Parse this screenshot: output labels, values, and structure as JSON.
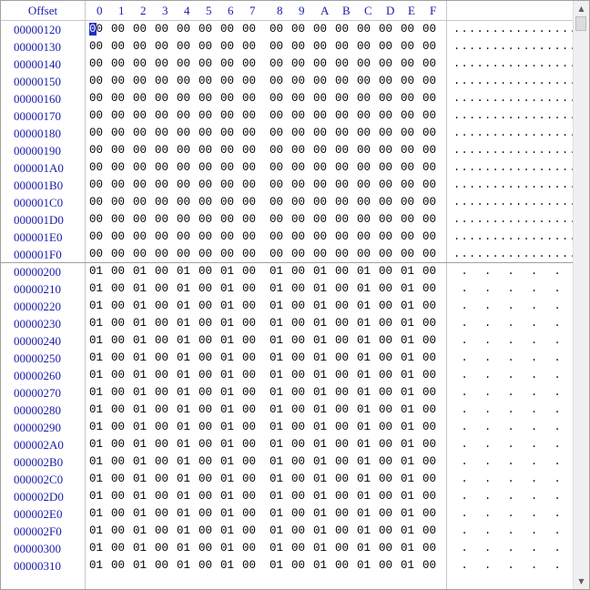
{
  "header": {
    "offset_label": "Offset",
    "columns": [
      "0",
      "1",
      "2",
      "3",
      "4",
      "5",
      "6",
      "7",
      "8",
      "9",
      "A",
      "B",
      "C",
      "D",
      "E",
      "F"
    ]
  },
  "rows": [
    {
      "offset": "00000120",
      "bytes": [
        "00",
        "00",
        "00",
        "00",
        "00",
        "00",
        "00",
        "00",
        "00",
        "00",
        "00",
        "00",
        "00",
        "00",
        "00",
        "00"
      ],
      "ascii": "................"
    },
    {
      "offset": "00000130",
      "bytes": [
        "00",
        "00",
        "00",
        "00",
        "00",
        "00",
        "00",
        "00",
        "00",
        "00",
        "00",
        "00",
        "00",
        "00",
        "00",
        "00"
      ],
      "ascii": "................"
    },
    {
      "offset": "00000140",
      "bytes": [
        "00",
        "00",
        "00",
        "00",
        "00",
        "00",
        "00",
        "00",
        "00",
        "00",
        "00",
        "00",
        "00",
        "00",
        "00",
        "00"
      ],
      "ascii": "................"
    },
    {
      "offset": "00000150",
      "bytes": [
        "00",
        "00",
        "00",
        "00",
        "00",
        "00",
        "00",
        "00",
        "00",
        "00",
        "00",
        "00",
        "00",
        "00",
        "00",
        "00"
      ],
      "ascii": "................"
    },
    {
      "offset": "00000160",
      "bytes": [
        "00",
        "00",
        "00",
        "00",
        "00",
        "00",
        "00",
        "00",
        "00",
        "00",
        "00",
        "00",
        "00",
        "00",
        "00",
        "00"
      ],
      "ascii": "................"
    },
    {
      "offset": "00000170",
      "bytes": [
        "00",
        "00",
        "00",
        "00",
        "00",
        "00",
        "00",
        "00",
        "00",
        "00",
        "00",
        "00",
        "00",
        "00",
        "00",
        "00"
      ],
      "ascii": "................"
    },
    {
      "offset": "00000180",
      "bytes": [
        "00",
        "00",
        "00",
        "00",
        "00",
        "00",
        "00",
        "00",
        "00",
        "00",
        "00",
        "00",
        "00",
        "00",
        "00",
        "00"
      ],
      "ascii": "................"
    },
    {
      "offset": "00000190",
      "bytes": [
        "00",
        "00",
        "00",
        "00",
        "00",
        "00",
        "00",
        "00",
        "00",
        "00",
        "00",
        "00",
        "00",
        "00",
        "00",
        "00"
      ],
      "ascii": "................"
    },
    {
      "offset": "000001A0",
      "bytes": [
        "00",
        "00",
        "00",
        "00",
        "00",
        "00",
        "00",
        "00",
        "00",
        "00",
        "00",
        "00",
        "00",
        "00",
        "00",
        "00"
      ],
      "ascii": "................"
    },
    {
      "offset": "000001B0",
      "bytes": [
        "00",
        "00",
        "00",
        "00",
        "00",
        "00",
        "00",
        "00",
        "00",
        "00",
        "00",
        "00",
        "00",
        "00",
        "00",
        "00"
      ],
      "ascii": "................"
    },
    {
      "offset": "000001C0",
      "bytes": [
        "00",
        "00",
        "00",
        "00",
        "00",
        "00",
        "00",
        "00",
        "00",
        "00",
        "00",
        "00",
        "00",
        "00",
        "00",
        "00"
      ],
      "ascii": "................"
    },
    {
      "offset": "000001D0",
      "bytes": [
        "00",
        "00",
        "00",
        "00",
        "00",
        "00",
        "00",
        "00",
        "00",
        "00",
        "00",
        "00",
        "00",
        "00",
        "00",
        "00"
      ],
      "ascii": "................"
    },
    {
      "offset": "000001E0",
      "bytes": [
        "00",
        "00",
        "00",
        "00",
        "00",
        "00",
        "00",
        "00",
        "00",
        "00",
        "00",
        "00",
        "00",
        "00",
        "00",
        "00"
      ],
      "ascii": "................"
    },
    {
      "offset": "000001F0",
      "bytes": [
        "00",
        "00",
        "00",
        "00",
        "00",
        "00",
        "00",
        "00",
        "00",
        "00",
        "00",
        "00",
        "00",
        "00",
        "00",
        "00"
      ],
      "ascii": "................"
    },
    {
      "offset": "00000200",
      "bytes": [
        "01",
        "00",
        "01",
        "00",
        "01",
        "00",
        "01",
        "00",
        "01",
        "00",
        "01",
        "00",
        "01",
        "00",
        "01",
        "00"
      ],
      "ascii": " .  .  .  .  . "
    },
    {
      "offset": "00000210",
      "bytes": [
        "01",
        "00",
        "01",
        "00",
        "01",
        "00",
        "01",
        "00",
        "01",
        "00",
        "01",
        "00",
        "01",
        "00",
        "01",
        "00"
      ],
      "ascii": " .  .  .  .  . "
    },
    {
      "offset": "00000220",
      "bytes": [
        "01",
        "00",
        "01",
        "00",
        "01",
        "00",
        "01",
        "00",
        "01",
        "00",
        "01",
        "00",
        "01",
        "00",
        "01",
        "00"
      ],
      "ascii": " .  .  .  .  . "
    },
    {
      "offset": "00000230",
      "bytes": [
        "01",
        "00",
        "01",
        "00",
        "01",
        "00",
        "01",
        "00",
        "01",
        "00",
        "01",
        "00",
        "01",
        "00",
        "01",
        "00"
      ],
      "ascii": " .  .  .  .  . "
    },
    {
      "offset": "00000240",
      "bytes": [
        "01",
        "00",
        "01",
        "00",
        "01",
        "00",
        "01",
        "00",
        "01",
        "00",
        "01",
        "00",
        "01",
        "00",
        "01",
        "00"
      ],
      "ascii": " .  .  .  .  . "
    },
    {
      "offset": "00000250",
      "bytes": [
        "01",
        "00",
        "01",
        "00",
        "01",
        "00",
        "01",
        "00",
        "01",
        "00",
        "01",
        "00",
        "01",
        "00",
        "01",
        "00"
      ],
      "ascii": " .  .  .  .  . "
    },
    {
      "offset": "00000260",
      "bytes": [
        "01",
        "00",
        "01",
        "00",
        "01",
        "00",
        "01",
        "00",
        "01",
        "00",
        "01",
        "00",
        "01",
        "00",
        "01",
        "00"
      ],
      "ascii": " .  .  .  .  . "
    },
    {
      "offset": "00000270",
      "bytes": [
        "01",
        "00",
        "01",
        "00",
        "01",
        "00",
        "01",
        "00",
        "01",
        "00",
        "01",
        "00",
        "01",
        "00",
        "01",
        "00"
      ],
      "ascii": " .  .  .  .  . "
    },
    {
      "offset": "00000280",
      "bytes": [
        "01",
        "00",
        "01",
        "00",
        "01",
        "00",
        "01",
        "00",
        "01",
        "00",
        "01",
        "00",
        "01",
        "00",
        "01",
        "00"
      ],
      "ascii": " .  .  .  .  . "
    },
    {
      "offset": "00000290",
      "bytes": [
        "01",
        "00",
        "01",
        "00",
        "01",
        "00",
        "01",
        "00",
        "01",
        "00",
        "01",
        "00",
        "01",
        "00",
        "01",
        "00"
      ],
      "ascii": " .  .  .  .  . "
    },
    {
      "offset": "000002A0",
      "bytes": [
        "01",
        "00",
        "01",
        "00",
        "01",
        "00",
        "01",
        "00",
        "01",
        "00",
        "01",
        "00",
        "01",
        "00",
        "01",
        "00"
      ],
      "ascii": " .  .  .  .  . "
    },
    {
      "offset": "000002B0",
      "bytes": [
        "01",
        "00",
        "01",
        "00",
        "01",
        "00",
        "01",
        "00",
        "01",
        "00",
        "01",
        "00",
        "01",
        "00",
        "01",
        "00"
      ],
      "ascii": " .  .  .  .  . "
    },
    {
      "offset": "000002C0",
      "bytes": [
        "01",
        "00",
        "01",
        "00",
        "01",
        "00",
        "01",
        "00",
        "01",
        "00",
        "01",
        "00",
        "01",
        "00",
        "01",
        "00"
      ],
      "ascii": " .  .  .  .  . "
    },
    {
      "offset": "000002D0",
      "bytes": [
        "01",
        "00",
        "01",
        "00",
        "01",
        "00",
        "01",
        "00",
        "01",
        "00",
        "01",
        "00",
        "01",
        "00",
        "01",
        "00"
      ],
      "ascii": " .  .  .  .  . "
    },
    {
      "offset": "000002E0",
      "bytes": [
        "01",
        "00",
        "01",
        "00",
        "01",
        "00",
        "01",
        "00",
        "01",
        "00",
        "01",
        "00",
        "01",
        "00",
        "01",
        "00"
      ],
      "ascii": " .  .  .  .  . "
    },
    {
      "offset": "000002F0",
      "bytes": [
        "01",
        "00",
        "01",
        "00",
        "01",
        "00",
        "01",
        "00",
        "01",
        "00",
        "01",
        "00",
        "01",
        "00",
        "01",
        "00"
      ],
      "ascii": " .  .  .  .  . "
    },
    {
      "offset": "00000300",
      "bytes": [
        "01",
        "00",
        "01",
        "00",
        "01",
        "00",
        "01",
        "00",
        "01",
        "00",
        "01",
        "00",
        "01",
        "00",
        "01",
        "00"
      ],
      "ascii": " .  .  .  .  . "
    },
    {
      "offset": "00000310",
      "bytes": [
        "01",
        "00",
        "01",
        "00",
        "01",
        "00",
        "01",
        "00",
        "01",
        "00",
        "01",
        "00",
        "01",
        "00",
        "01",
        "00"
      ],
      "ascii": " .  .  .  .  . "
    }
  ],
  "selection": {
    "row": 0,
    "byte": 0
  },
  "colors": {
    "offset_text": "#1a1aa8",
    "caret": "#2030c0"
  },
  "scrollbar": {
    "up_icon": "arrow-up-icon",
    "down_icon": "arrow-down-icon",
    "position_fraction": 0.0
  }
}
